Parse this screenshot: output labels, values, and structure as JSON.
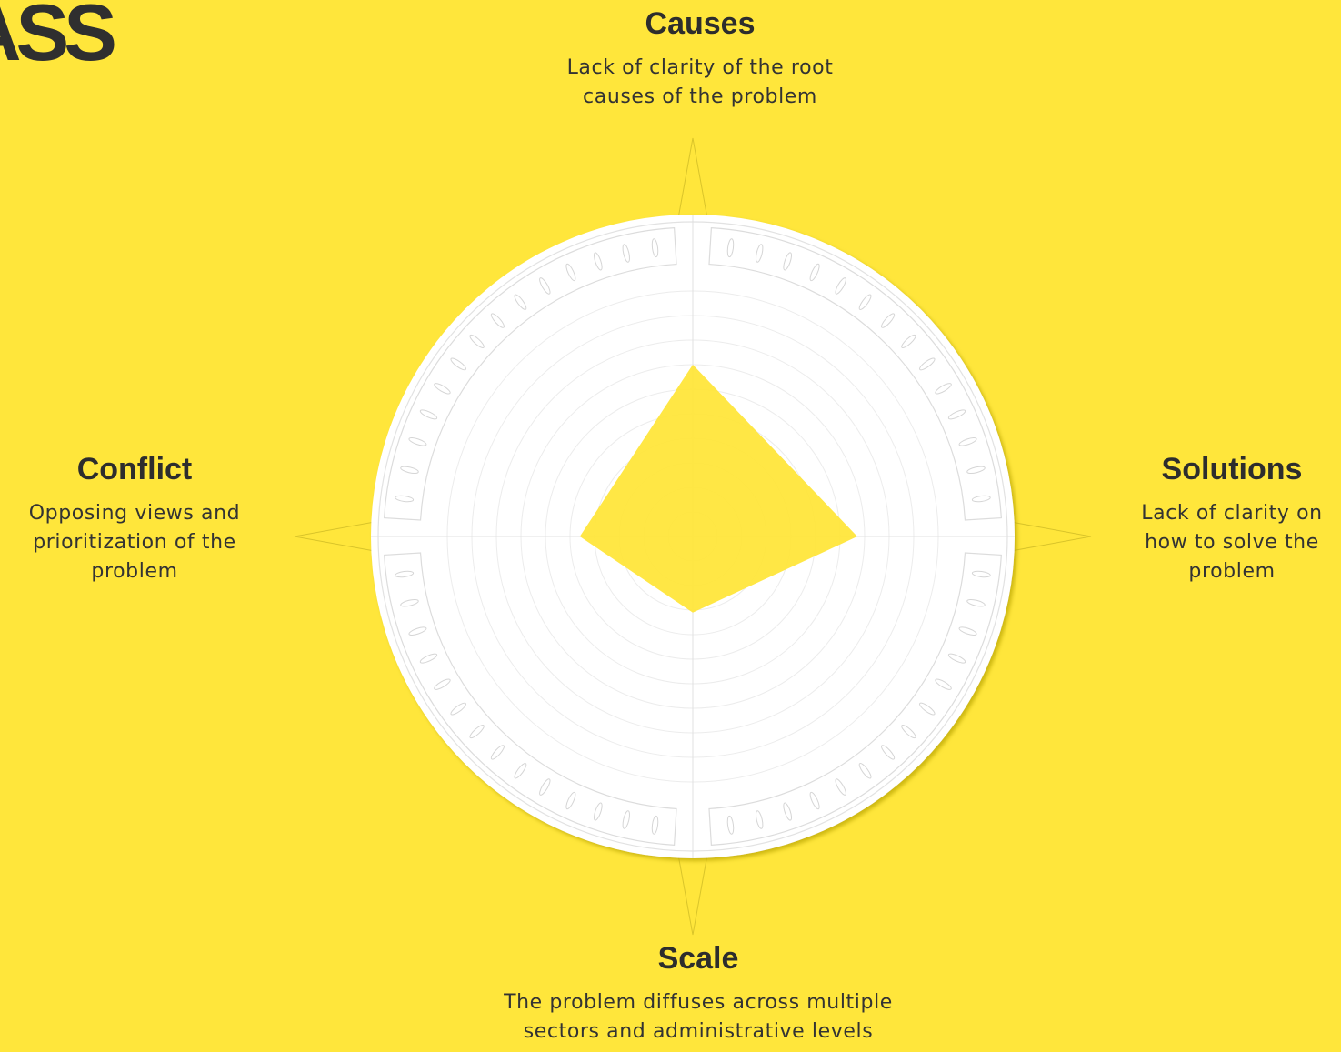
{
  "logo": {
    "text": "ASS"
  },
  "axes": {
    "causes": {
      "title": "Causes",
      "desc": [
        "Lack of clarity of the root",
        "causes of the problem"
      ]
    },
    "solutions": {
      "title": "Solutions",
      "desc": [
        "Lack of clarity on",
        "how to solve the",
        "problem"
      ]
    },
    "scale": {
      "title": "Scale",
      "desc": [
        "The problem diffuses across multiple",
        "sectors and administrative levels"
      ]
    },
    "conflict": {
      "title": "Conflict",
      "desc": [
        "Opposing views and",
        "prioritization of the",
        "problem"
      ]
    }
  },
  "radar": {
    "scale_max": 10,
    "values": {
      "causes": 7,
      "solutions": 6.7,
      "scale": 3.1,
      "conflict": 4.6
    },
    "fill": "#ffe63b",
    "background": "#ffe63b"
  }
}
